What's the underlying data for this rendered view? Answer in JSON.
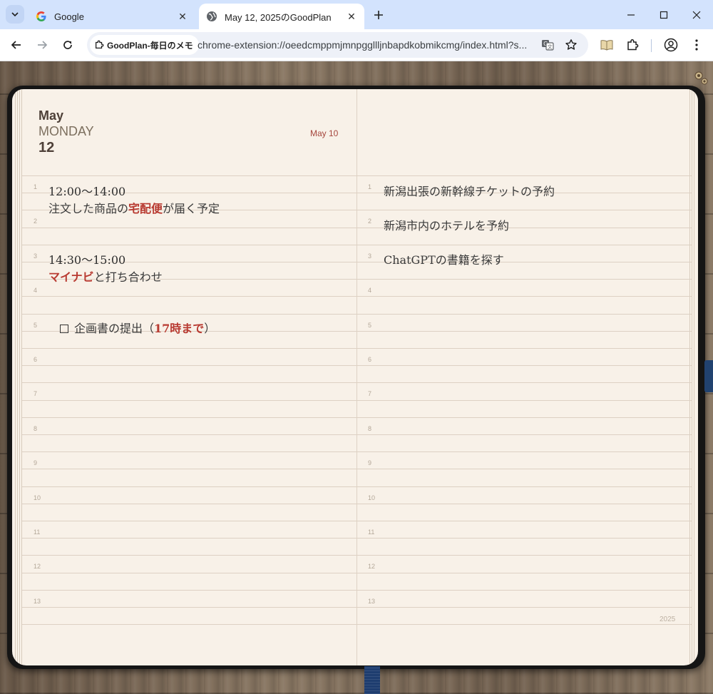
{
  "browser": {
    "tabs": [
      {
        "title": "Google",
        "icon": "google-icon",
        "active": false
      },
      {
        "title": "May 12, 2025のGoodPlan",
        "icon": "globe-icon",
        "active": true
      }
    ],
    "site_chip": "GoodPlan-毎日のメモ",
    "url": "chrome-extension://oeedcmppmjmnpggllljnbapdkobmikcmg/index.html?s..."
  },
  "planner": {
    "month": "May",
    "weekday": "MONDAY",
    "day": "12",
    "small_date": "May 10",
    "year": "2025",
    "line_numbers": [
      "1",
      "2",
      "3",
      "4",
      "5",
      "6",
      "7",
      "8",
      "9",
      "10",
      "11",
      "12",
      "13"
    ],
    "left": {
      "e1_time": "12:00〜14:00",
      "e1_pre": "注文した商品の",
      "e1_highlight": "宅配便",
      "e1_post": "が届く予定",
      "e3_time": "14:30〜15:00",
      "e3_highlight": "マイナビ",
      "e3_post": "と打ち合わせ",
      "e5_pre": "企画書の提出（",
      "e5_highlight": "17時まで",
      "e5_post": "）"
    },
    "right": {
      "r1": "新潟出張の新幹線チケットの予約",
      "r2": "新潟市内のホテルを予約",
      "r3": "ChatGPTの書籍を探す"
    },
    "colors": {
      "paper": "#f8f1e8",
      "highlight": "#b83a31",
      "rule": "#ddd0c3"
    }
  }
}
